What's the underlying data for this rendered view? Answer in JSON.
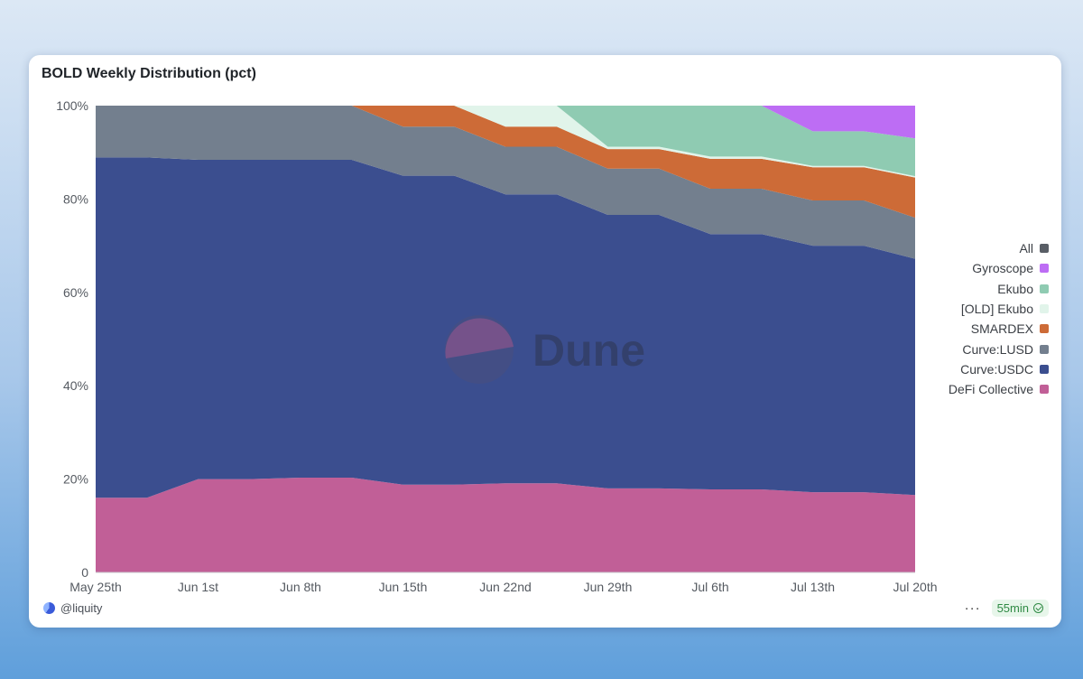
{
  "title": "BOLD Weekly Distribution (pct)",
  "watermark": "Dune",
  "footer": {
    "user": "@liquity",
    "refresh": "55min",
    "more": "···"
  },
  "colors": {
    "All": "#595e66",
    "Gyroscope": "#bd6df4",
    "Ekubo": "#8fcbb2",
    "[OLD] Ekubo": "#e1f4ea",
    "SMARDEX": "#cd6b37",
    "Curve:LUSD": "#737f8e",
    "Curve:USDC": "#3b4e8f",
    "DeFi Collective": "#c15f97"
  },
  "chart_data": {
    "type": "area",
    "stacked": true,
    "normalized": true,
    "x": [
      "May 25th",
      "May 28th",
      "Jun 1st",
      "Jun 4th",
      "Jun 8th",
      "Jun 11th",
      "Jun 15th",
      "Jun 18th",
      "Jun 22nd",
      "Jun 25th",
      "Jun 29th",
      "Jul 2nd",
      "Jul 6th",
      "Jul 9th",
      "Jul 13th",
      "Jul 16th",
      "Jul 20th"
    ],
    "xticks": [
      "May 25th",
      "Jun 1st",
      "Jun 8th",
      "Jun 15th",
      "Jun 22nd",
      "Jun 29th",
      "Jul 6th",
      "Jul 13th",
      "Jul 20th"
    ],
    "yticks": [
      "0",
      "20%",
      "40%",
      "60%",
      "80%",
      "100%"
    ],
    "ylim": [
      0,
      100
    ],
    "legend_position": "right",
    "legend": [
      "All",
      "Gyroscope",
      "Ekubo",
      "[OLD] Ekubo",
      "SMARDEX",
      "Curve:LUSD",
      "Curve:USDC",
      "DeFi Collective"
    ],
    "series": [
      {
        "name": "DeFi Collective",
        "values": [
          16,
          16,
          20,
          20,
          20.3,
          20.3,
          18.8,
          18.8,
          19.1,
          19.1,
          18,
          18,
          17.8,
          17.8,
          17.2,
          17.2,
          16.6
        ]
      },
      {
        "name": "Curve:USDC",
        "values": [
          72.9,
          72.9,
          68.4,
          68.4,
          68.1,
          68.1,
          66.2,
          66.2,
          61.9,
          61.9,
          58.6,
          58.6,
          54.7,
          54.7,
          52.8,
          52.8,
          50.6
        ]
      },
      {
        "name": "Curve:LUSD",
        "values": [
          11.1,
          11.1,
          11.6,
          11.6,
          11.6,
          11.6,
          10.5,
          10.5,
          10.2,
          10.2,
          9.9,
          9.9,
          9.7,
          9.7,
          9.7,
          9.7,
          8.8
        ]
      },
      {
        "name": "SMARDEX",
        "values": [
          0,
          0,
          0,
          0,
          0,
          0,
          4.5,
          4.5,
          4.3,
          4.3,
          4.2,
          4.2,
          6.4,
          6.4,
          7.1,
          7.1,
          8.6
        ]
      },
      {
        "name": "[OLD] Ekubo",
        "values": [
          0,
          0,
          0,
          0,
          0,
          0,
          0,
          0,
          4.5,
          4.5,
          0.5,
          0.5,
          0.5,
          0.5,
          0.3,
          0.3,
          0.3
        ]
      },
      {
        "name": "Ekubo",
        "values": [
          0,
          0,
          0,
          0,
          0,
          0,
          0,
          0,
          0,
          0,
          8.8,
          8.8,
          10.9,
          10.9,
          7.4,
          7.4,
          8.1
        ]
      },
      {
        "name": "Gyroscope",
        "values": [
          0,
          0,
          0,
          0,
          0,
          0,
          0,
          0,
          0,
          0,
          0,
          0,
          0,
          0,
          5.5,
          5.5,
          7
        ]
      }
    ]
  }
}
